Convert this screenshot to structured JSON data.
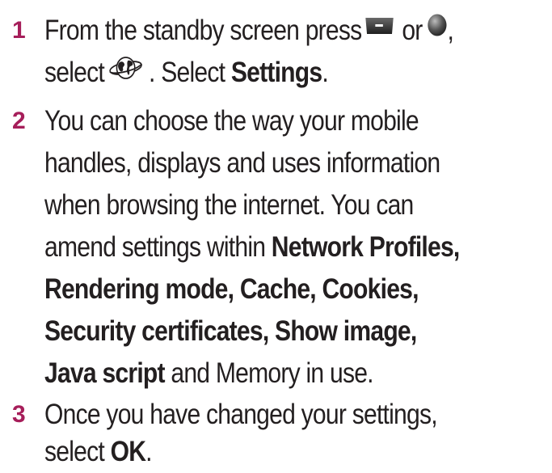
{
  "steps": [
    {
      "number": "1",
      "line1_a": "From the standby screen press",
      "line1_b": "or",
      "line1_c": ",",
      "line2_a": "select",
      "line2_b": ". Select",
      "line2_bold": "Settings",
      "line2_c": ".",
      "icons": [
        "softkey-icon",
        "ok-button-icon",
        "browser-globe-icon"
      ]
    },
    {
      "number": "2",
      "lines": [
        "You can choose the way your mobile",
        "handles, displays and uses information",
        "when browsing the internet. You can"
      ],
      "line4_a": "amend settings within",
      "line4_bold": "Network Profiles,",
      "line5_bold": "Rendering mode, Cache, Cookies,",
      "line6_bold": "Security certificates, Show image,",
      "line7_bold": "Java script",
      "line7_b": "and Memory in use."
    },
    {
      "number": "3",
      "line1": "Once you have changed your settings,",
      "line2_a": "select",
      "line2_bold": "OK",
      "line2_b": "."
    }
  ],
  "colors": {
    "step_number": "#a61e5a",
    "text": "#231f20"
  }
}
